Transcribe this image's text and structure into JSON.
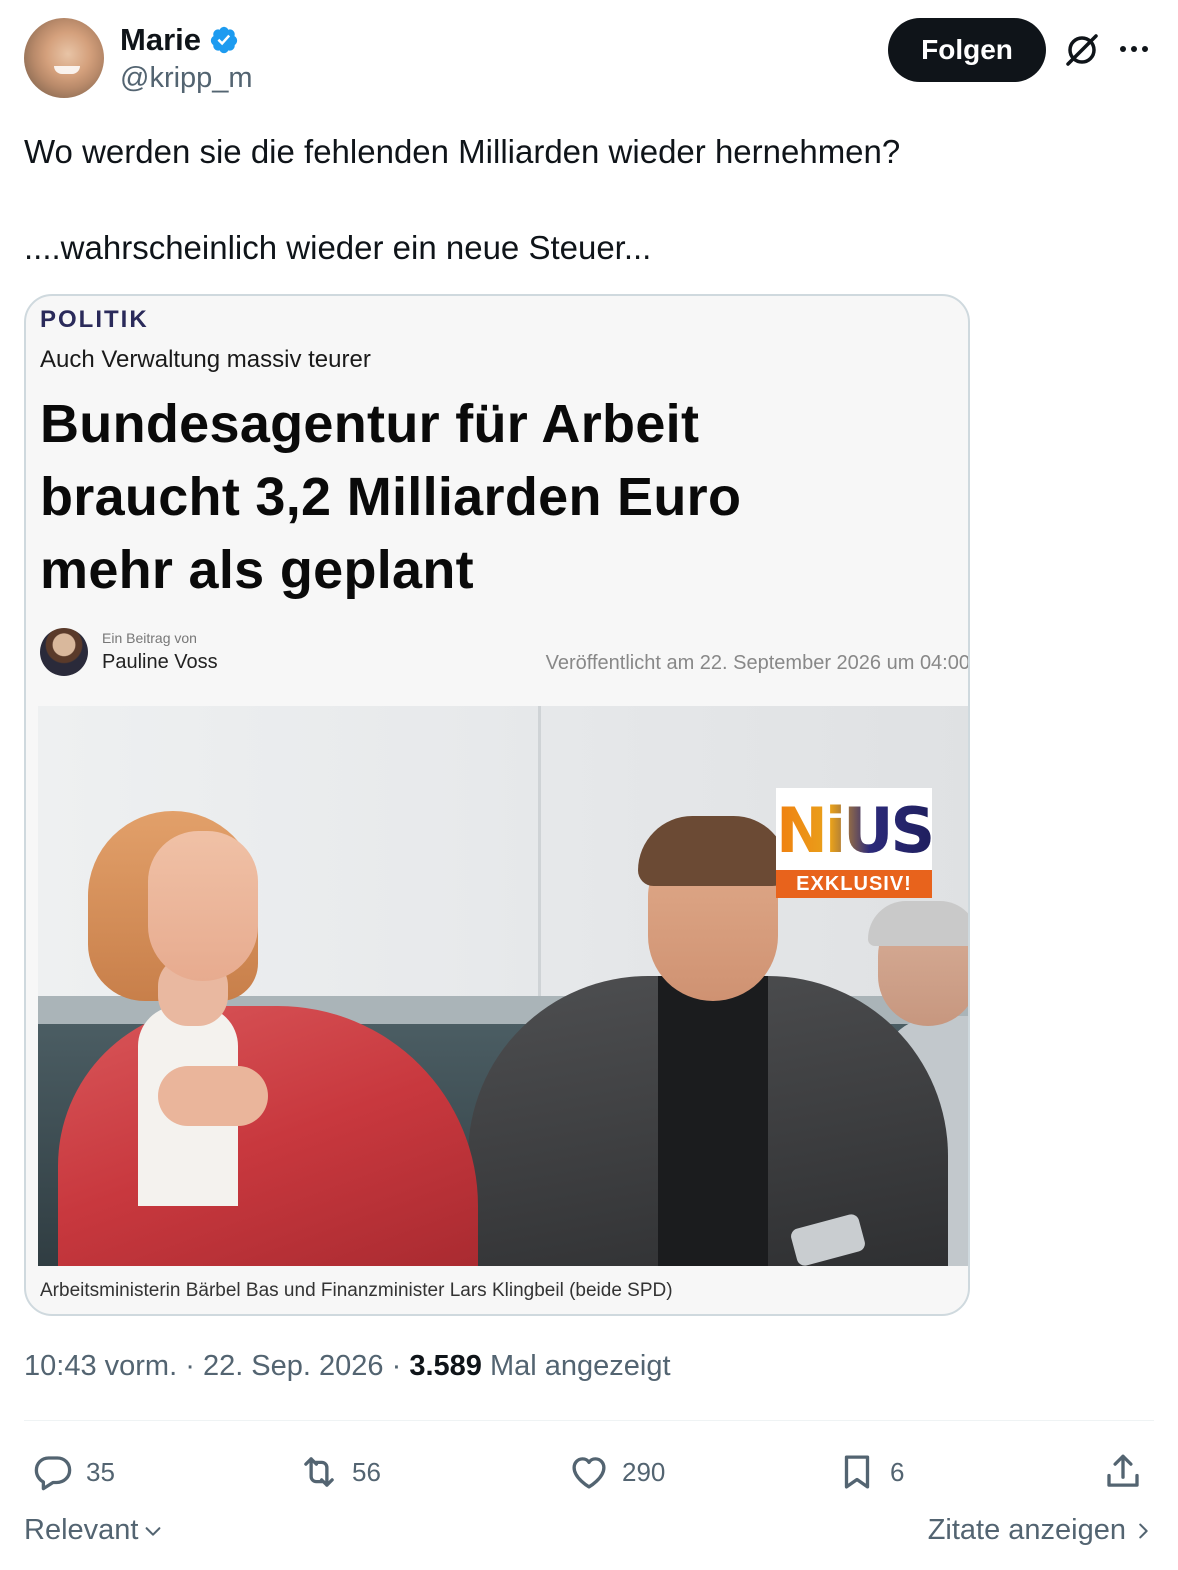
{
  "author": {
    "display_name": "Marie",
    "handle": "@kripp_m",
    "verified": true
  },
  "follow_label": "Folgen",
  "tweet": {
    "line1": "Wo werden sie die fehlenden Milliarden wieder hernehmen?",
    "line2": "....wahrscheinlich wieder ein neue Steuer..."
  },
  "article": {
    "kicker": "POLITIK",
    "subhead": "Auch Verwaltung massiv teurer",
    "headline_lines": [
      "Bundesagentur für Arbeit",
      "braucht 3,2 Milliarden Euro",
      "mehr als geplant"
    ],
    "by_label": "Ein Beitrag von",
    "author_name": "Pauline Voss",
    "published": "Veröffentlicht am 22. September 2026 um 04:00",
    "badge_logo": "NiUS",
    "badge_tag": "EXKLUSIV!",
    "caption": "Arbeitsministerin Bärbel Bas und Finanzminister Lars Klingbeil (beide SPD)"
  },
  "meta": {
    "time": "10:43 vorm.",
    "sep1": "·",
    "date": "22. Sep. 2026",
    "sep2": "·",
    "views": "3.589",
    "views_label": "Mal angezeigt"
  },
  "actions": {
    "replies": "35",
    "reposts": "56",
    "likes": "290",
    "bookmarks": "6"
  },
  "footer": {
    "sort_label": "Relevant",
    "quotes_label": "Zitate anzeigen"
  },
  "colors": {
    "text": "#0f1419",
    "muted": "#536471",
    "verified": "#1d9bf0",
    "border": "#cfd9de"
  }
}
